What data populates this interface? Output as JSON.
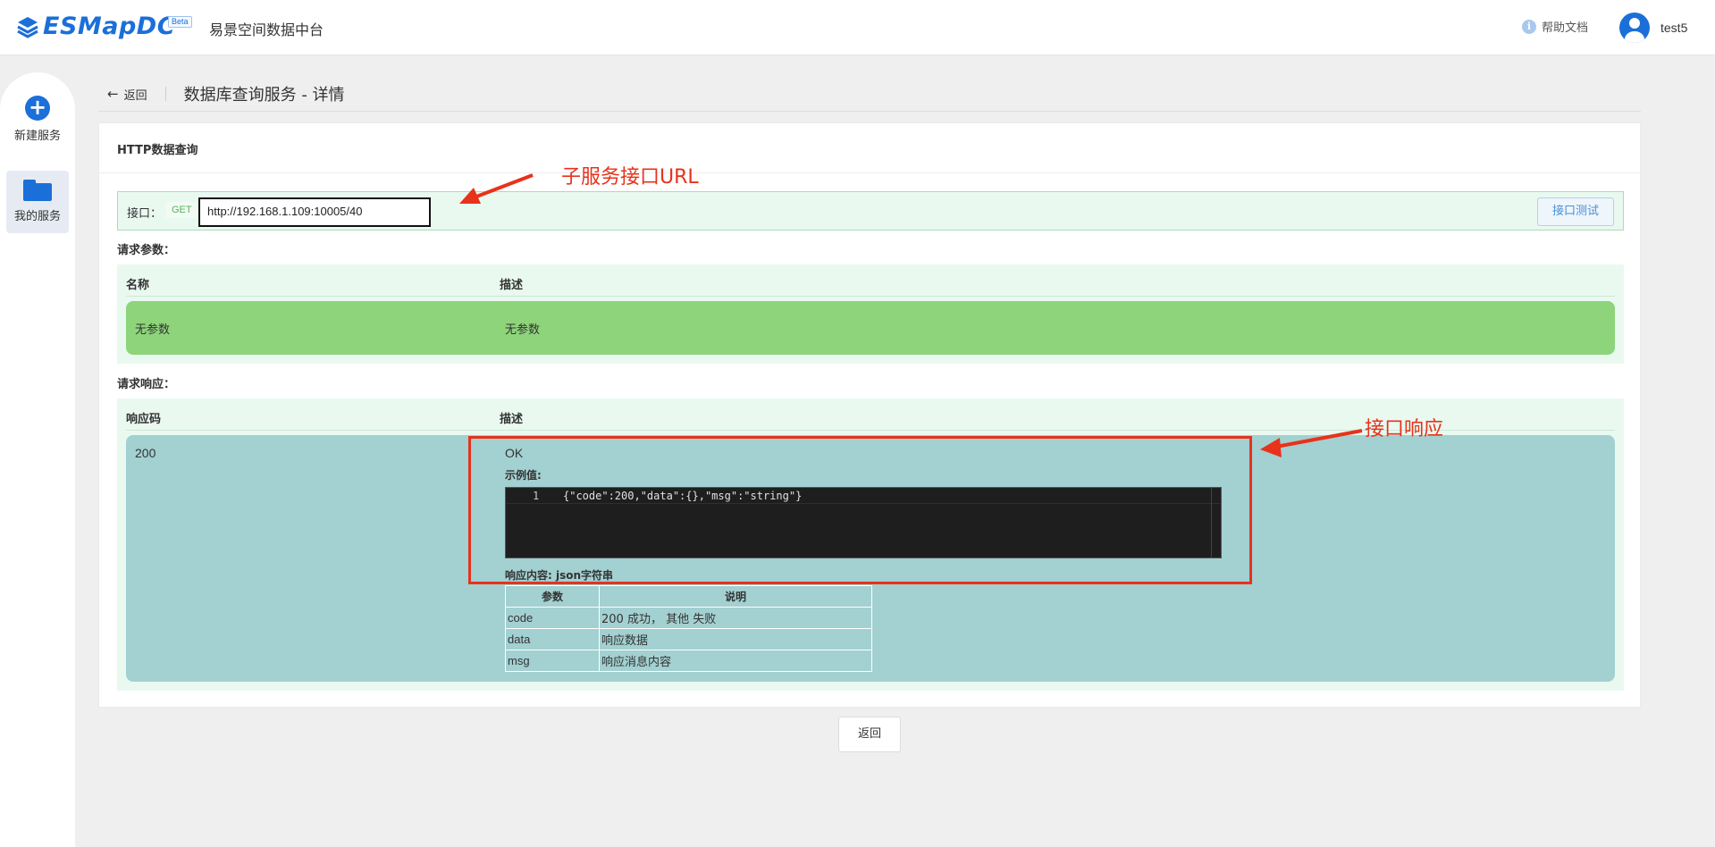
{
  "header": {
    "logo_text": "ESMapDC",
    "beta": "Beta",
    "app_subtitle": "易景空间数据中台",
    "help_icon_glyph": "i",
    "help_label": "帮助文档",
    "username": "test5",
    "brand_color": "#1b6fd8"
  },
  "sidebar": {
    "items": [
      {
        "label": "新建服务",
        "icon": "plus-circle-icon"
      },
      {
        "label": "我的服务",
        "icon": "folder-icon"
      }
    ]
  },
  "breadcrumb": {
    "back_arrow": "←",
    "back_label": "返回",
    "title": "数据库查询服务 - 详情"
  },
  "card": {
    "title": "HTTP数据查询",
    "endpoint": {
      "label": "接口：",
      "method": "GET",
      "url": "http://192.168.1.109:10005/40",
      "test_button": "接口测试"
    },
    "params": {
      "section_label": "请求参数：",
      "headers": [
        "名称",
        "描述"
      ],
      "row": {
        "name": "无参数",
        "desc": "无参数"
      }
    },
    "response": {
      "section_label": "请求响应：",
      "headers": [
        "响应码",
        "描述"
      ],
      "code": "200",
      "status_text": "OK",
      "example_label": "示例值:",
      "example_line_number": "1",
      "example_code": "{\"code\":200,\"data\":{},\"msg\":\"string\"}",
      "content_label": "响应内容: json字符串",
      "table_headers": [
        "参数",
        "说明"
      ],
      "table_rows": [
        {
          "param": "code",
          "desc": "200 成功， 其他 失败"
        },
        {
          "param": "data",
          "desc": "响应数据"
        },
        {
          "param": "msg",
          "desc": "响应消息内容"
        }
      ]
    }
  },
  "bottom": {
    "back_button": "返回"
  },
  "annotations": {
    "url_note": "子服务接口URL",
    "response_note": "接口响应",
    "color": "#e8321b"
  }
}
